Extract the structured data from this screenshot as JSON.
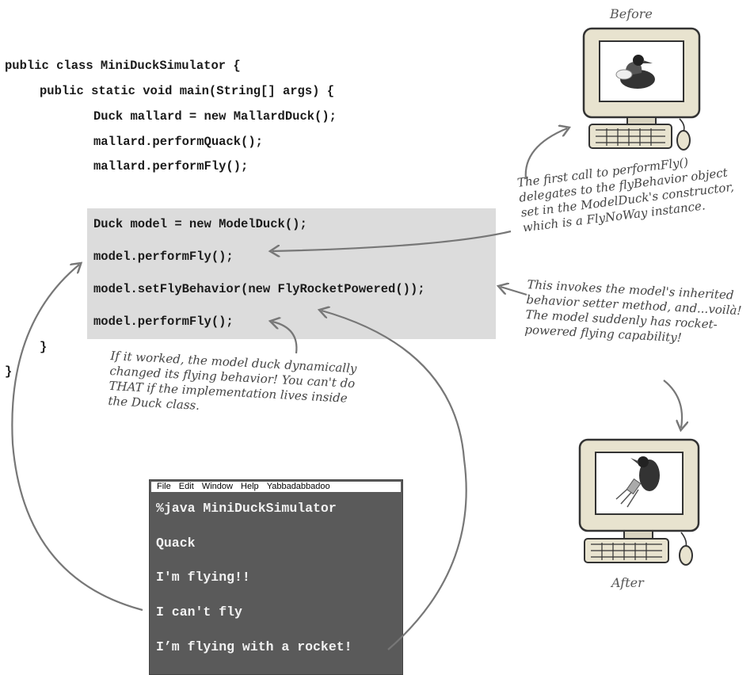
{
  "code": {
    "lines": [
      "public class MiniDuckSimulator {",
      "public static void main(String[] args) {",
      "Duck mallard = new MallardDuck();",
      "mallard.performQuack();",
      "mallard.performFly();",
      "Duck model = new ModelDuck();",
      "model.performFly();",
      "model.setFlyBehavior(new FlyRocketPowered());",
      "model.performFly();",
      "}",
      "}"
    ]
  },
  "notes": {
    "first_call": [
      "The first call to performFly()",
      "delegates to the flyBehavior object",
      "set in the ModelDuck's constructor,",
      "which is a FlyNoWay instance."
    ],
    "invokes": [
      "This invokes the model's inherited",
      "behavior setter method, and...voilà!",
      "The model suddenly has rocket-",
      "powered flying capability!"
    ],
    "if_worked": [
      "If it worked, the model duck dynamically",
      "changed its flying behavior! You can't do",
      "THAT if the implementation lives inside",
      "the Duck class."
    ]
  },
  "terminal": {
    "menu": [
      "File",
      "Edit",
      "Window",
      "Help",
      "Yabbadabbadoo"
    ],
    "lines": [
      "%java MiniDuckSimulator",
      "Quack",
      "I'm flying!!",
      "I can't fly",
      "I’m flying with a rocket!"
    ]
  },
  "illustrations": {
    "before_label": "Before",
    "after_label": "After",
    "icons": [
      "computer-before-icon",
      "computer-after-icon",
      "duck-icon",
      "rocket-duck-icon"
    ]
  }
}
